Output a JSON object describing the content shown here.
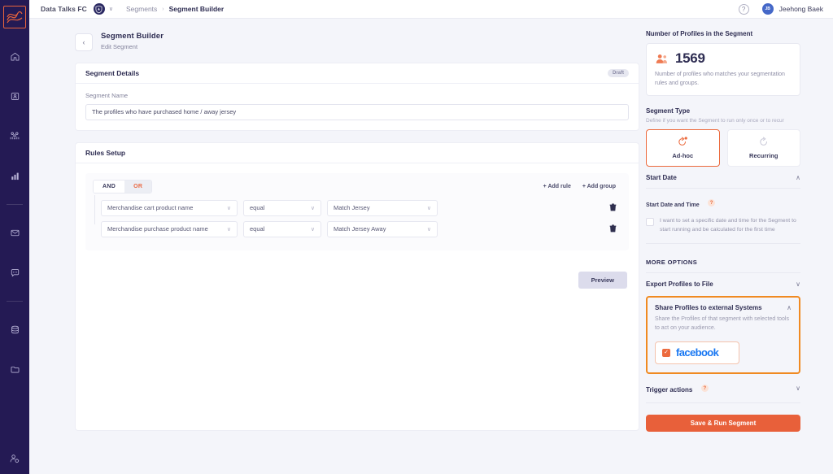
{
  "topbar": {
    "org": "Data Talks FC",
    "shield_icon": "club-shield-icon",
    "caret": "∨",
    "breadcrumb_parent": "Segments",
    "breadcrumb_sep": "›",
    "breadcrumb_current": "Segment Builder",
    "help": "?",
    "avatar_initials": "JB",
    "user_name": "Jeehong Baek"
  },
  "rail": {
    "logo_name": "datatalks-logo",
    "items": [
      {
        "icon": "home-icon"
      },
      {
        "icon": "profile-card-icon"
      },
      {
        "icon": "audience-people-icon"
      },
      {
        "icon": "bar-chart-icon"
      },
      {
        "icon": "mail-envelope-icon"
      },
      {
        "icon": "chat-bubble-icon"
      },
      {
        "icon": "database-icon"
      },
      {
        "icon": "folder-icon"
      }
    ],
    "bottom_icon": "user-settings-icon"
  },
  "page": {
    "back": "‹",
    "title": "Segment Builder",
    "subtitle": "Edit Segment"
  },
  "details": {
    "title": "Segment Details",
    "badge": "Draft",
    "name_label": "Segment Name",
    "name_value": "The profiles who have purchased home / away jersey",
    "name_placeholder": "Segment Name"
  },
  "rules": {
    "title": "Rules Setup",
    "and_label": "AND",
    "or_label": "OR",
    "active_operator": "OR",
    "add_rule": "+ Add rule",
    "add_group": "+ Add group",
    "chevron": "∨",
    "rows": [
      {
        "attribute": "Merchandise cart product name",
        "operator": "equal",
        "value": "Match Jersey",
        "delete_icon": "trash-icon"
      },
      {
        "attribute": "Merchandise purchase product name",
        "operator": "equal",
        "value": "Match Jersey Away",
        "delete_icon": "trash-icon"
      }
    ],
    "preview": "Preview"
  },
  "sidepanel": {
    "profiles_title": "Number of Profiles in the Segment",
    "profiles_icon": "people-group-icon",
    "profiles_count": "1569",
    "profiles_desc": "Number of profiles who matches your segmentation rules and groups.",
    "segment_type_title": "Segment Type",
    "segment_type_desc": "Define if you want the Segment to run only once or to recur",
    "types": [
      {
        "label": "Ad-hoc",
        "icon": "run-once-icon",
        "selected": true
      },
      {
        "label": "Recurring",
        "icon": "recurring-loop-icon",
        "selected": false
      }
    ],
    "start_date_title": "Start Date",
    "start_date_chevron": "∧",
    "start_datetime_label": "Start Date and Time",
    "help_badge": "?",
    "start_checkbox_checked": false,
    "start_checkbox_text": "I want to set a specific date and time for the Segment to start running and be calculated for the first time",
    "more_options": "MORE OPTIONS",
    "export_title": "Export Profiles to File",
    "export_chevron": "∨",
    "share_title": "Share Profiles to external Systems",
    "share_chevron": "∧",
    "share_desc": "Share the Profiles of that segment with selected tools to act on your audience.",
    "facebook_label": "facebook",
    "facebook_checked": true,
    "facebook_check_glyph": "✓",
    "trigger_title": "Trigger actions",
    "trigger_chevron": "∨",
    "save_label": "Save & Run Segment"
  },
  "colors": {
    "accent_orange": "#e8603a",
    "highlight_orange": "#f08a21",
    "rail_navy": "#241a54",
    "facebook_blue": "#1877f2",
    "text_dark": "#2e2d52"
  }
}
